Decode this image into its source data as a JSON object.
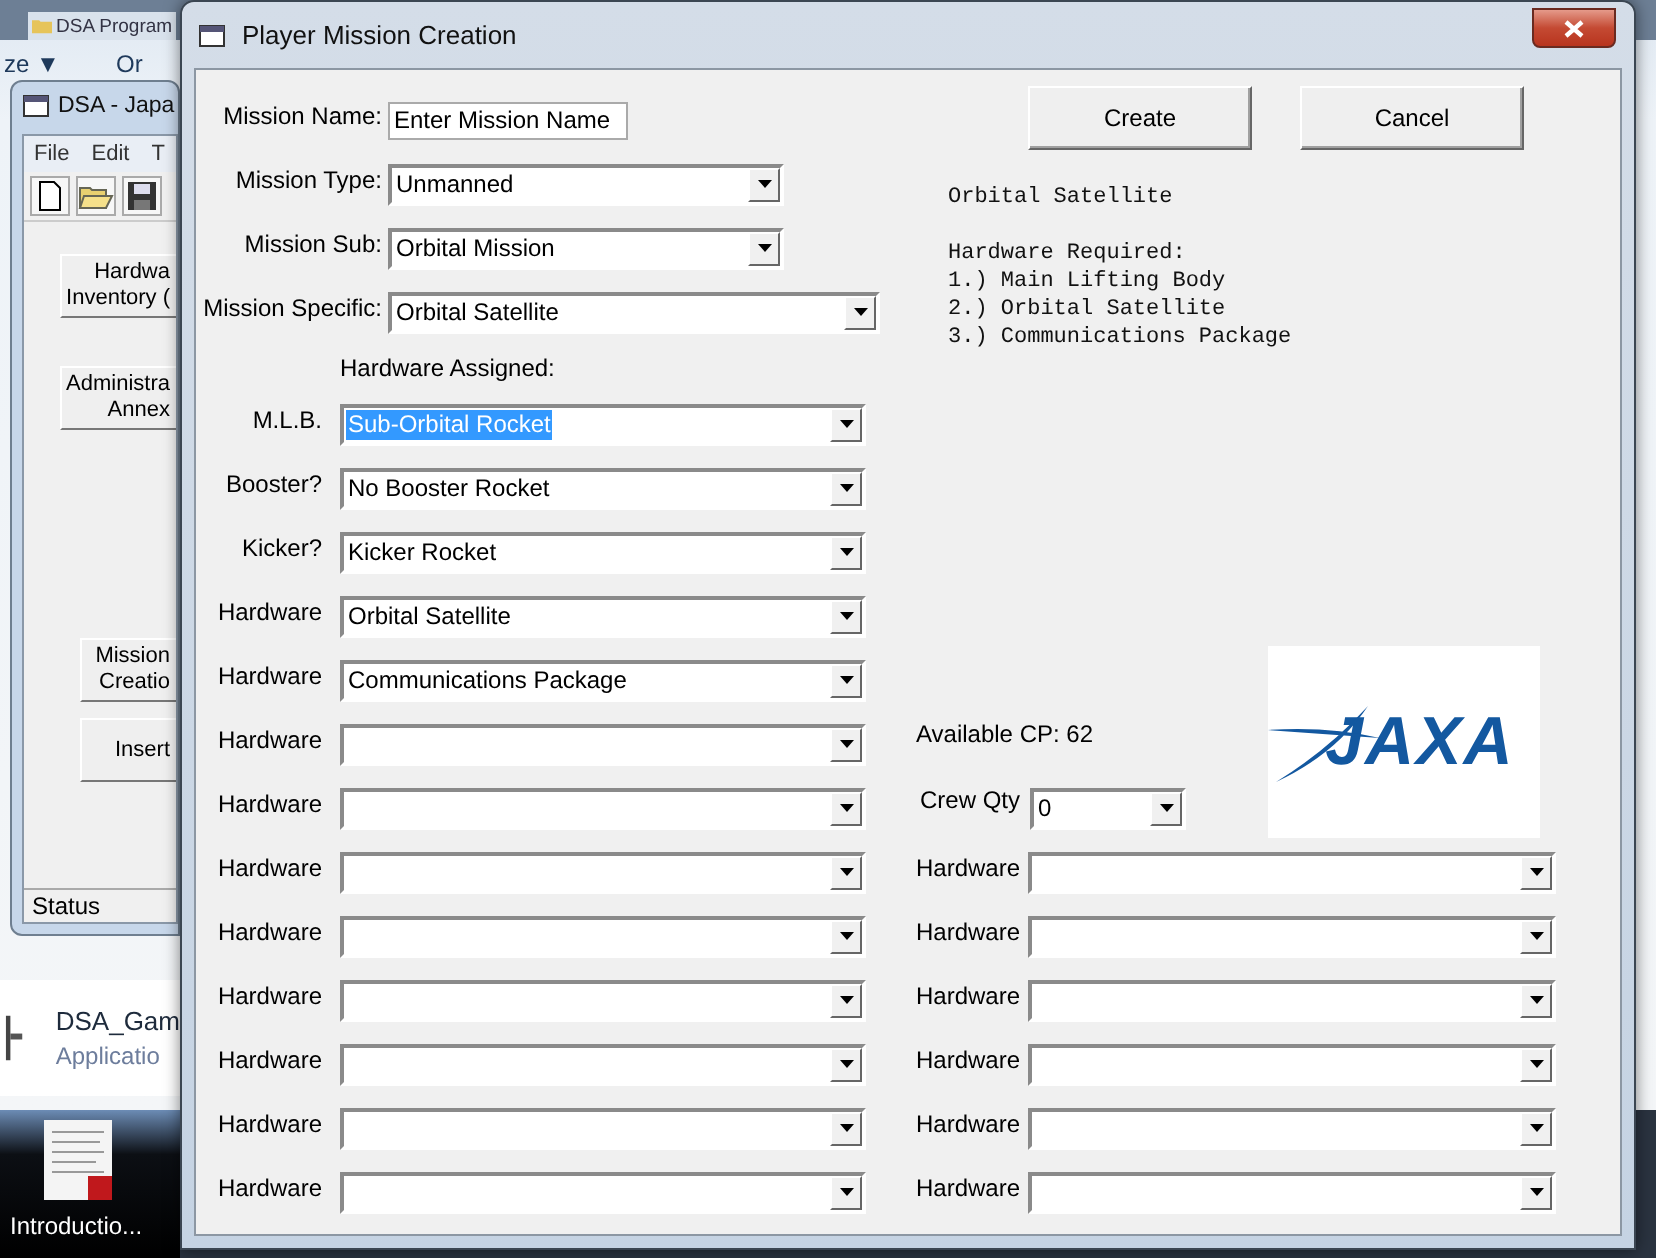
{
  "explorer": {
    "address": "DSA Program",
    "toolbar": [
      "ze ▼",
      "Or"
    ]
  },
  "back_window": {
    "title": "DSA - Japa",
    "menu": [
      "File",
      "Edit",
      "T"
    ],
    "buttons": [
      {
        "lines": [
          "Hardwa",
          "Inventory ("
        ]
      },
      {
        "lines": [
          "Administra",
          "Annex"
        ]
      },
      {
        "lines": [
          "Mission",
          "Creatio"
        ]
      },
      {
        "lines": [
          "Insert"
        ]
      }
    ],
    "status": "Status"
  },
  "file_item": {
    "name": "DSA_Gam",
    "type": "Applicatio"
  },
  "taskbar": {
    "label": "Introductio..."
  },
  "dialog": {
    "title": "Player Mission Creation",
    "mission_fields": [
      {
        "kind": "text",
        "label": "Mission Name:",
        "value": "Enter Mission Name"
      },
      {
        "kind": "dropdown",
        "label": "Mission Type:",
        "value": "Unmanned"
      },
      {
        "kind": "dropdown",
        "label": "Mission Sub:",
        "value": "Orbital Mission"
      },
      {
        "kind": "dropdown",
        "label": "Mission Specific:",
        "value": "Orbital Satellite"
      }
    ],
    "hardware_heading": "Hardware Assigned:",
    "hardware_left": [
      {
        "label": "M.L.B.",
        "value": "Sub-Orbital Rocket",
        "highlighted": true
      },
      {
        "label": "Booster?",
        "value": "No Booster Rocket",
        "highlighted": false
      },
      {
        "label": "Kicker?",
        "value": "Kicker Rocket",
        "highlighted": false
      },
      {
        "label": "Hardware",
        "value": "Orbital Satellite",
        "highlighted": false
      },
      {
        "label": "Hardware",
        "value": "Communications Package",
        "highlighted": false
      },
      {
        "label": "Hardware"
      },
      {
        "label": "Hardware"
      },
      {
        "label": "Hardware"
      },
      {
        "label": "Hardware"
      },
      {
        "label": "Hardware"
      },
      {
        "label": "Hardware"
      },
      {
        "label": "Hardware"
      },
      {
        "label": "Hardware"
      }
    ],
    "buttons": [
      "Create",
      "Cancel"
    ],
    "description": {
      "title": "Orbital Satellite",
      "heading": "Hardware Required:",
      "items": [
        "1.) Main Lifting Body",
        "2.) Orbital Satellite",
        "3.) Communications Package"
      ]
    },
    "available_cp": "Available CP: 62",
    "crew_qty": {
      "label": "Crew Qty",
      "value": "0"
    },
    "logo": "JAXA",
    "hardware_right": [
      {
        "label": "Hardware"
      },
      {
        "label": "Hardware"
      },
      {
        "label": "Hardware"
      },
      {
        "label": "Hardware"
      },
      {
        "label": "Hardware"
      },
      {
        "label": "Hardware"
      }
    ]
  }
}
